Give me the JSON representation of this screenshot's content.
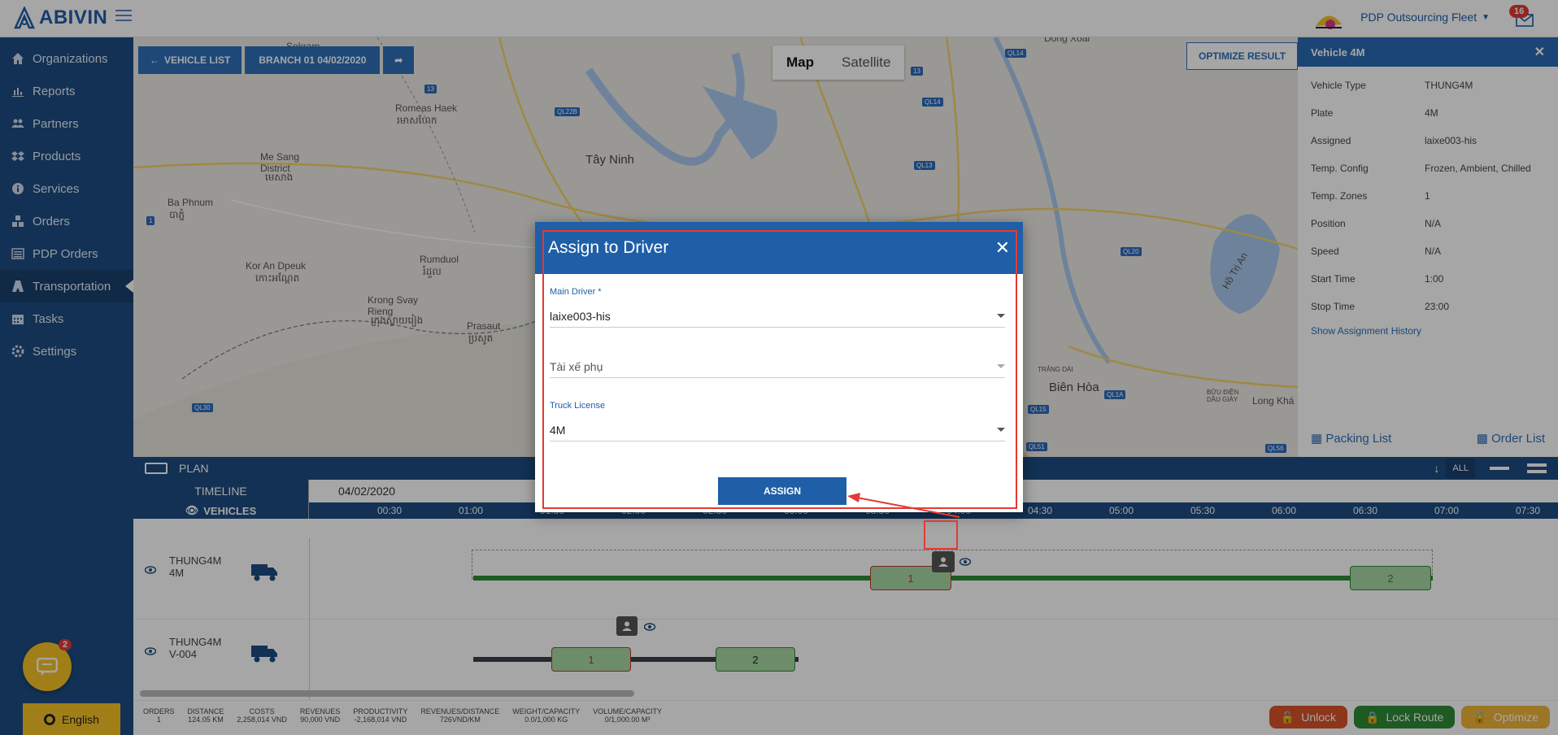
{
  "app": {
    "brand": "ABIVIN",
    "fleet_name": "PDP Outsourcing Fleet",
    "notifications": "16"
  },
  "sidebar": {
    "items": [
      {
        "label": "Organizations",
        "icon": "home-icon"
      },
      {
        "label": "Reports",
        "icon": "chart-icon"
      },
      {
        "label": "Partners",
        "icon": "users-icon"
      },
      {
        "label": "Products",
        "icon": "dropbox-icon"
      },
      {
        "label": "Services",
        "icon": "info-icon"
      },
      {
        "label": "Orders",
        "icon": "cubes-icon"
      },
      {
        "label": "PDP Orders",
        "icon": "list-icon"
      },
      {
        "label": "Transportation",
        "icon": "road-icon"
      },
      {
        "label": "Tasks",
        "icon": "calendar-icon"
      },
      {
        "label": "Settings",
        "icon": "gear-icon"
      }
    ],
    "active": "Transportation",
    "chat_badge": "2",
    "language": "English"
  },
  "map": {
    "vehicle_list": "VEHICLE LIST",
    "branch": "BRANCH 01 04/02/2020",
    "map_btn": "Map",
    "satellite_btn": "Satellite",
    "optimize_result": "OPTIMIZE RESULT",
    "labels": [
      "Sokram",
      "Romeas Haek",
      "រមាសហែក",
      "Me Sang District",
      "មេសាង",
      "Ba Phnum",
      "បាភ្នំ",
      "Kor An Dpeuk",
      "កោះអណ្ដែត",
      "Rumduol",
      "រំដួល",
      "Krong Svay Rieng",
      "ក្រុងស្វាយរៀង",
      "Prasaut",
      "ប្រសូត",
      "Tây Ninh",
      "Dong Xoai",
      "Biên Hòa",
      "Long Khá",
      "Hồ Trị An",
      "TRẢNG DÀI",
      "BỬU ĐIỀN DẦU GIÂY"
    ],
    "shields": [
      "QL22B",
      "13",
      "QL14",
      "QL14",
      "QL13",
      "QL20",
      "QL15",
      "QL1A",
      "QL51",
      "QL56",
      "QL30",
      "1",
      "13"
    ]
  },
  "vehicle_panel": {
    "title": "Vehicle 4M",
    "rows": [
      {
        "k": "Vehicle Type",
        "v": "THUNG4M"
      },
      {
        "k": "Plate",
        "v": "4M"
      },
      {
        "k": "Assigned",
        "v": "laixe003-his"
      },
      {
        "k": "Temp. Config",
        "v": "Frozen, Ambient, Chilled"
      },
      {
        "k": "Temp. Zones",
        "v": "1"
      },
      {
        "k": "Position",
        "v": "N/A"
      },
      {
        "k": "Speed",
        "v": "N/A"
      },
      {
        "k": "Start Time",
        "v": "1:00"
      },
      {
        "k": "Stop Time",
        "v": "23:00"
      }
    ],
    "history": "Show Assignment History",
    "packing": "Packing List",
    "order": "Order List"
  },
  "plan": {
    "title": "PLAN",
    "all": "ALL",
    "timeline": "TIMELINE",
    "date": "04/02/2020",
    "vehicles": "VEHICLES",
    "hours": [
      "00:30",
      "01:00",
      "01:30",
      "02:00",
      "02:30",
      "03:00",
      "03:30",
      "04:00",
      "04:30",
      "05:00",
      "05:30",
      "06:00",
      "06:30",
      "07:00",
      "07:30"
    ],
    "rows": [
      {
        "name": "THUNG4M",
        "plate": "4M",
        "seg1": "1",
        "seg2": "2"
      },
      {
        "name": "THUNG4M",
        "plate": "V-004",
        "seg1": "1",
        "seg2": "2"
      }
    ]
  },
  "stats": [
    {
      "k": "ORDERS",
      "v": "1"
    },
    {
      "k": "DISTANCE",
      "v": "124.05 KM"
    },
    {
      "k": "COSTS",
      "v": "2,258,014 VND"
    },
    {
      "k": "REVENUES",
      "v": "90,000 VND"
    },
    {
      "k": "PRODUCTIVITY",
      "v": "-2,168,014 VND"
    },
    {
      "k": "REVENUES/DISTANCE",
      "v": "726VND/KM"
    },
    {
      "k": "WEIGHT/CAPACITY",
      "v": "0.0/1,000 KG"
    },
    {
      "k": "VOLUME/CAPACITY",
      "v": "0/1,000.00 M³"
    }
  ],
  "actions": {
    "unlock": "Unlock",
    "lock_route": "Lock Route",
    "optimize": "Optimize"
  },
  "modal": {
    "title": "Assign to Driver",
    "main_driver_label": "Main Driver *",
    "main_driver": "laixe003-his",
    "assistant_placeholder": "Tài xế phụ",
    "truck_license_label": "Truck License",
    "truck_license": "4M",
    "assign": "ASSIGN"
  },
  "colors": {
    "primary": "#1e5fa8",
    "sidebar": "#1d4c81",
    "accent": "#f7c425",
    "unlock": "#d9532a",
    "lock": "#2e8b36"
  }
}
